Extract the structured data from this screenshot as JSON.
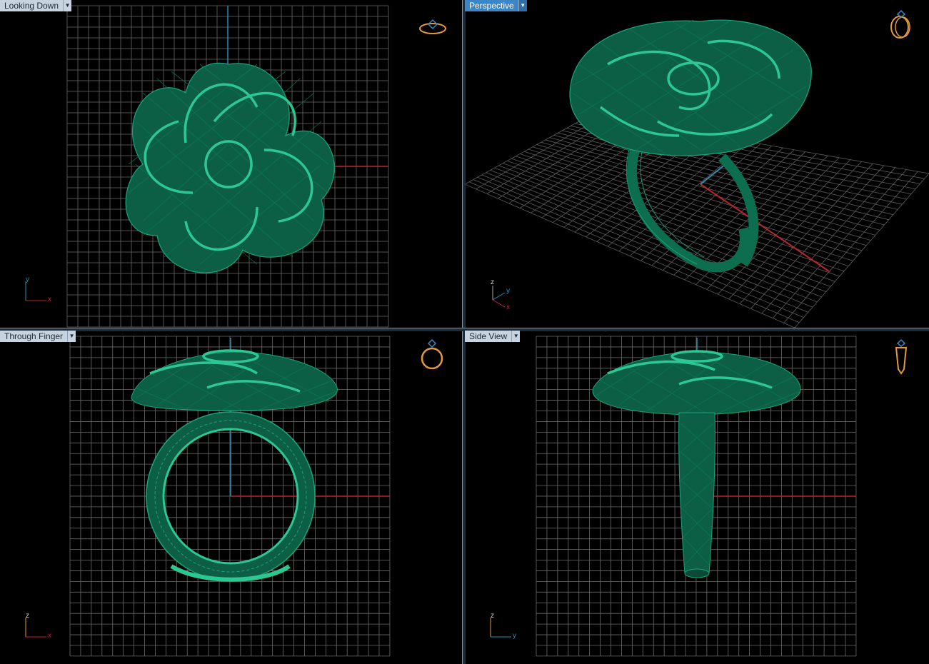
{
  "viewports": {
    "top_left": {
      "label": "Looking Down",
      "active": false
    },
    "top_right": {
      "label": "Perspective",
      "active": true
    },
    "bottom_left": {
      "label": "Through Finger",
      "active": false
    },
    "bottom_right": {
      "label": "Side View",
      "active": false
    }
  },
  "axis_labels": {
    "top_left": {
      "vertical": "y",
      "horizontal": "x"
    },
    "top_right": {
      "vertical": "z",
      "diagonal": "y",
      "horizontal": "x"
    },
    "bottom_left": {
      "vertical": "z",
      "horizontal": "x"
    },
    "bottom_right": {
      "vertical": "z",
      "horizontal": "y"
    }
  },
  "colors": {
    "model_green": "#0f7a5a",
    "grid": "#6b6b6b",
    "x_axis": "#c0252a",
    "y_axis": "#2a8fb3",
    "orientation_icon": "#e39a3a",
    "active_tab": "#3b86c6"
  },
  "icons": {
    "top_left": "ring-top-view-icon",
    "top_right": "ring-perspective-icon",
    "bottom_left": "ring-front-view-icon",
    "bottom_right": "ring-side-view-icon"
  }
}
